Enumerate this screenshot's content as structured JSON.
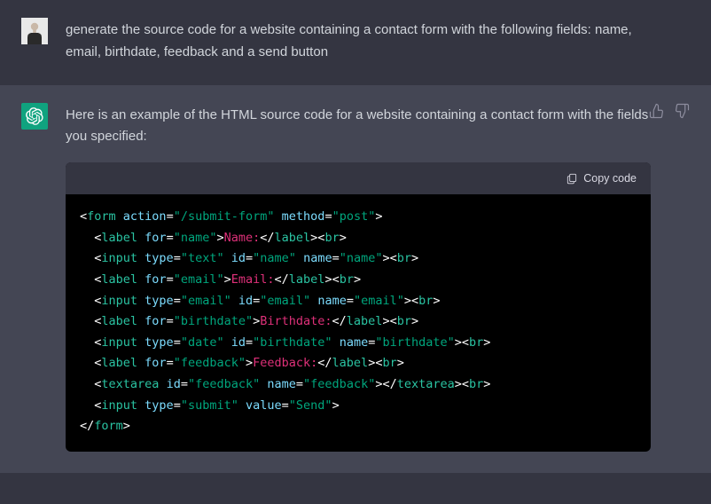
{
  "user": {
    "message": "generate the source code for a website containing a contact form with the following fields: name, email, birthdate, feedback and a send button"
  },
  "assistant": {
    "intro": "Here is an example of the HTML source code for a website containing a contact form with the fields you specified:",
    "code": {
      "copy_label": "Copy code",
      "tokens": [
        [
          [
            "punc",
            "<"
          ],
          [
            "tag",
            "form"
          ],
          [
            "punc",
            " "
          ],
          [
            "attr",
            "action"
          ],
          [
            "eq",
            "="
          ],
          [
            "str",
            "\"/submit-form\""
          ],
          [
            "punc",
            " "
          ],
          [
            "attr",
            "method"
          ],
          [
            "eq",
            "="
          ],
          [
            "str",
            "\"post\""
          ],
          [
            "punc",
            ">"
          ]
        ],
        [
          [
            "punc",
            "  <"
          ],
          [
            "tag",
            "label"
          ],
          [
            "punc",
            " "
          ],
          [
            "attr",
            "for"
          ],
          [
            "eq",
            "="
          ],
          [
            "str",
            "\"name\""
          ],
          [
            "punc",
            ">"
          ],
          [
            "text",
            "Name:"
          ],
          [
            "punc",
            "</"
          ],
          [
            "tag",
            "label"
          ],
          [
            "punc",
            "><"
          ],
          [
            "tag",
            "br"
          ],
          [
            "punc",
            ">"
          ]
        ],
        [
          [
            "punc",
            "  <"
          ],
          [
            "tag",
            "input"
          ],
          [
            "punc",
            " "
          ],
          [
            "attr",
            "type"
          ],
          [
            "eq",
            "="
          ],
          [
            "str",
            "\"text\""
          ],
          [
            "punc",
            " "
          ],
          [
            "attr",
            "id"
          ],
          [
            "eq",
            "="
          ],
          [
            "str",
            "\"name\""
          ],
          [
            "punc",
            " "
          ],
          [
            "attr",
            "name"
          ],
          [
            "eq",
            "="
          ],
          [
            "str",
            "\"name\""
          ],
          [
            "punc",
            "><"
          ],
          [
            "tag",
            "br"
          ],
          [
            "punc",
            ">"
          ]
        ],
        [
          [
            "punc",
            "  <"
          ],
          [
            "tag",
            "label"
          ],
          [
            "punc",
            " "
          ],
          [
            "attr",
            "for"
          ],
          [
            "eq",
            "="
          ],
          [
            "str",
            "\"email\""
          ],
          [
            "punc",
            ">"
          ],
          [
            "text",
            "Email:"
          ],
          [
            "punc",
            "</"
          ],
          [
            "tag",
            "label"
          ],
          [
            "punc",
            "><"
          ],
          [
            "tag",
            "br"
          ],
          [
            "punc",
            ">"
          ]
        ],
        [
          [
            "punc",
            "  <"
          ],
          [
            "tag",
            "input"
          ],
          [
            "punc",
            " "
          ],
          [
            "attr",
            "type"
          ],
          [
            "eq",
            "="
          ],
          [
            "str",
            "\"email\""
          ],
          [
            "punc",
            " "
          ],
          [
            "attr",
            "id"
          ],
          [
            "eq",
            "="
          ],
          [
            "str",
            "\"email\""
          ],
          [
            "punc",
            " "
          ],
          [
            "attr",
            "name"
          ],
          [
            "eq",
            "="
          ],
          [
            "str",
            "\"email\""
          ],
          [
            "punc",
            "><"
          ],
          [
            "tag",
            "br"
          ],
          [
            "punc",
            ">"
          ]
        ],
        [
          [
            "punc",
            "  <"
          ],
          [
            "tag",
            "label"
          ],
          [
            "punc",
            " "
          ],
          [
            "attr",
            "for"
          ],
          [
            "eq",
            "="
          ],
          [
            "str",
            "\"birthdate\""
          ],
          [
            "punc",
            ">"
          ],
          [
            "text",
            "Birthdate:"
          ],
          [
            "punc",
            "</"
          ],
          [
            "tag",
            "label"
          ],
          [
            "punc",
            "><"
          ],
          [
            "tag",
            "br"
          ],
          [
            "punc",
            ">"
          ]
        ],
        [
          [
            "punc",
            "  <"
          ],
          [
            "tag",
            "input"
          ],
          [
            "punc",
            " "
          ],
          [
            "attr",
            "type"
          ],
          [
            "eq",
            "="
          ],
          [
            "str",
            "\"date\""
          ],
          [
            "punc",
            " "
          ],
          [
            "attr",
            "id"
          ],
          [
            "eq",
            "="
          ],
          [
            "str",
            "\"birthdate\""
          ],
          [
            "punc",
            " "
          ],
          [
            "attr",
            "name"
          ],
          [
            "eq",
            "="
          ],
          [
            "str",
            "\"birthdate\""
          ],
          [
            "punc",
            "><"
          ],
          [
            "tag",
            "br"
          ],
          [
            "punc",
            ">"
          ]
        ],
        [
          [
            "punc",
            "  <"
          ],
          [
            "tag",
            "label"
          ],
          [
            "punc",
            " "
          ],
          [
            "attr",
            "for"
          ],
          [
            "eq",
            "="
          ],
          [
            "str",
            "\"feedback\""
          ],
          [
            "punc",
            ">"
          ],
          [
            "text",
            "Feedback:"
          ],
          [
            "punc",
            "</"
          ],
          [
            "tag",
            "label"
          ],
          [
            "punc",
            "><"
          ],
          [
            "tag",
            "br"
          ],
          [
            "punc",
            ">"
          ]
        ],
        [
          [
            "punc",
            "  <"
          ],
          [
            "tag",
            "textarea"
          ],
          [
            "punc",
            " "
          ],
          [
            "attr",
            "id"
          ],
          [
            "eq",
            "="
          ],
          [
            "str",
            "\"feedback\""
          ],
          [
            "punc",
            " "
          ],
          [
            "attr",
            "name"
          ],
          [
            "eq",
            "="
          ],
          [
            "str",
            "\"feedback\""
          ],
          [
            "punc",
            "></"
          ],
          [
            "tag",
            "textarea"
          ],
          [
            "punc",
            "><"
          ],
          [
            "tag",
            "br"
          ],
          [
            "punc",
            ">"
          ]
        ],
        [
          [
            "punc",
            "  <"
          ],
          [
            "tag",
            "input"
          ],
          [
            "punc",
            " "
          ],
          [
            "attr",
            "type"
          ],
          [
            "eq",
            "="
          ],
          [
            "str",
            "\"submit\""
          ],
          [
            "punc",
            " "
          ],
          [
            "attr",
            "value"
          ],
          [
            "eq",
            "="
          ],
          [
            "str",
            "\"Send\""
          ],
          [
            "punc",
            ">"
          ]
        ],
        [
          [
            "punc",
            "</"
          ],
          [
            "tag",
            "form"
          ],
          [
            "punc",
            ">"
          ]
        ]
      ]
    }
  }
}
